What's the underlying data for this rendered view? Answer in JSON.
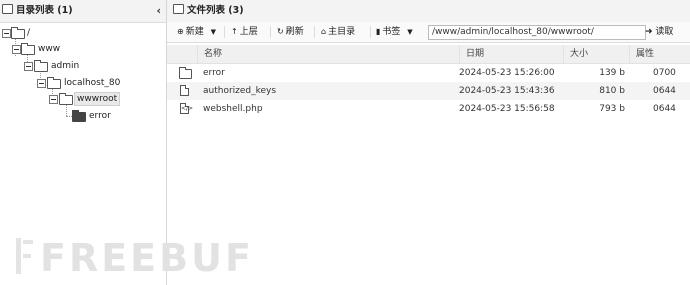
{
  "left_panel": {
    "title": "目录列表 (1)",
    "collapse_glyph": "‹",
    "tree": [
      {
        "label": "/"
      },
      {
        "label": "www"
      },
      {
        "label": "admin"
      },
      {
        "label": "localhost_80"
      },
      {
        "label": "wwwroot"
      },
      {
        "label": "error"
      }
    ]
  },
  "right_panel": {
    "title": "文件列表 (3)",
    "toolbar": {
      "new_label": "新建",
      "up_label": "上层",
      "refresh_label": "刷新",
      "home_label": "主目录",
      "bookmark_label": "书签",
      "path_value": "/www/admin/localhost_80/wwwroot/",
      "read_label": "读取"
    },
    "columns": [
      "名称",
      "日期",
      "大小",
      "属性"
    ],
    "files": [
      {
        "icon": "folder-icon",
        "name": "error",
        "date": "2024-05-23 15:26:00",
        "size": "139 b",
        "perm": "0700"
      },
      {
        "icon": "file-icon",
        "name": "authorized_keys",
        "date": "2024-05-23 15:43:36",
        "size": "810 b",
        "perm": "0644"
      },
      {
        "icon": "php-file-icon",
        "name": "webshell.php",
        "date": "2024-05-23 15:56:58",
        "size": "793 b",
        "perm": "0644"
      }
    ]
  },
  "watermark": "FREEBUF"
}
